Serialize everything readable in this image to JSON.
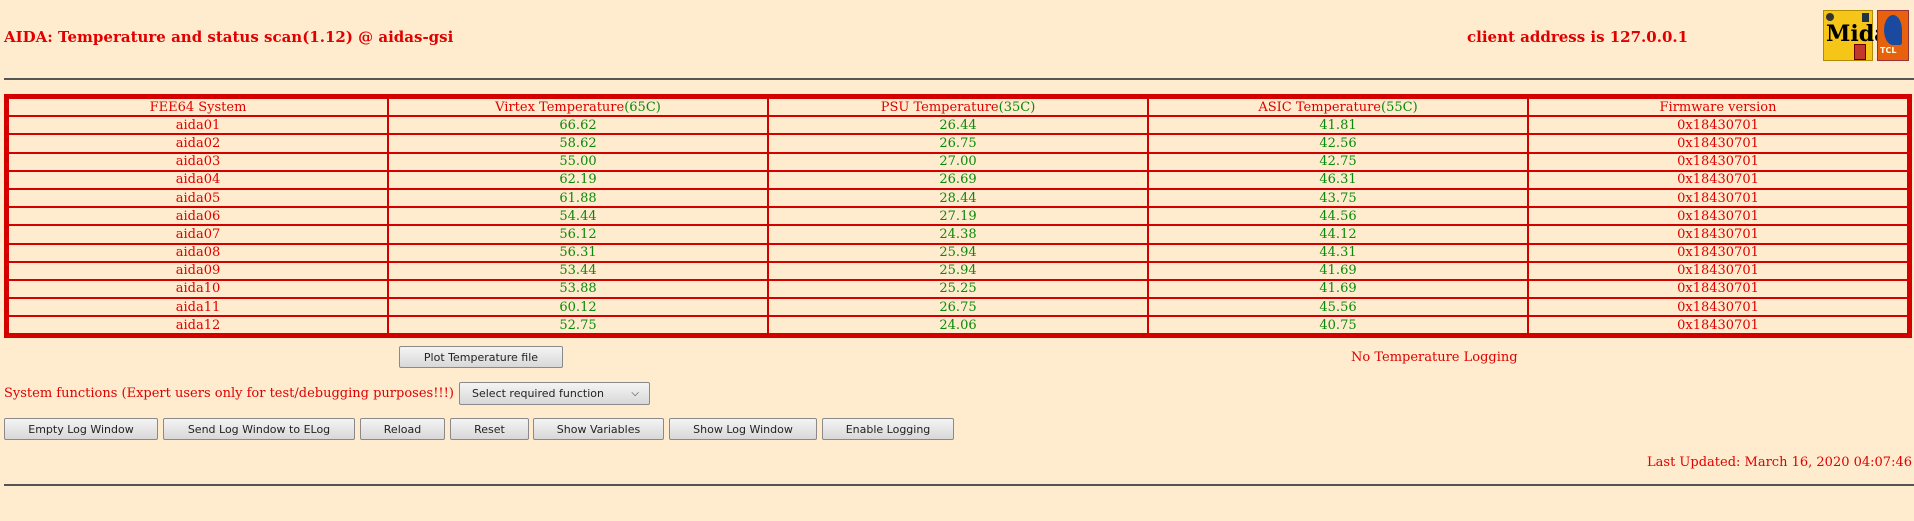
{
  "header": {
    "title": "AIDA: Temperature and status scan(1.12) @ aidas-gsi",
    "client_address": "client address is 127.0.0.1",
    "logo_midas_text": "Midas",
    "logo_tcl_text": "TCL"
  },
  "table": {
    "headers": {
      "system": "FEE64 System",
      "virtex": "Virtex Temperature",
      "virtex_limit": "(65C)",
      "psu": "PSU Temperature",
      "psu_limit": "(35C)",
      "asic": "ASIC Temperature",
      "asic_limit": "(55C)",
      "firmware": "Firmware version"
    },
    "rows": [
      {
        "system": "aida01",
        "virtex": "66.62",
        "psu": "26.44",
        "asic": "41.81",
        "firmware": "0x18430701"
      },
      {
        "system": "aida02",
        "virtex": "58.62",
        "psu": "26.75",
        "asic": "42.56",
        "firmware": "0x18430701"
      },
      {
        "system": "aida03",
        "virtex": "55.00",
        "psu": "27.00",
        "asic": "42.75",
        "firmware": "0x18430701"
      },
      {
        "system": "aida04",
        "virtex": "62.19",
        "psu": "26.69",
        "asic": "46.31",
        "firmware": "0x18430701"
      },
      {
        "system": "aida05",
        "virtex": "61.88",
        "psu": "28.44",
        "asic": "43.75",
        "firmware": "0x18430701"
      },
      {
        "system": "aida06",
        "virtex": "54.44",
        "psu": "27.19",
        "asic": "44.56",
        "firmware": "0x18430701"
      },
      {
        "system": "aida07",
        "virtex": "56.12",
        "psu": "24.38",
        "asic": "44.12",
        "firmware": "0x18430701"
      },
      {
        "system": "aida08",
        "virtex": "56.31",
        "psu": "25.94",
        "asic": "44.31",
        "firmware": "0x18430701"
      },
      {
        "system": "aida09",
        "virtex": "53.44",
        "psu": "25.94",
        "asic": "41.69",
        "firmware": "0x18430701"
      },
      {
        "system": "aida10",
        "virtex": "53.88",
        "psu": "25.25",
        "asic": "41.69",
        "firmware": "0x18430701"
      },
      {
        "system": "aida11",
        "virtex": "60.12",
        "psu": "26.75",
        "asic": "45.56",
        "firmware": "0x18430701"
      },
      {
        "system": "aida12",
        "virtex": "52.75",
        "psu": "24.06",
        "asic": "40.75",
        "firmware": "0x18430701"
      }
    ]
  },
  "controls": {
    "plot_button": "Plot Temperature file",
    "logging_status": "No Temperature Logging",
    "system_functions_label": "System functions (Expert users only for test/debugging purposes!!!)",
    "select_function": "Select required function",
    "buttons": {
      "empty_log": "Empty Log Window",
      "send_log": "Send Log Window to ELog",
      "reload": "Reload",
      "reset": "Reset",
      "show_variables": "Show Variables",
      "show_log": "Show Log Window",
      "enable_logging": "Enable Logging"
    }
  },
  "footer": {
    "last_updated": "Last Updated: March 16, 2020 04:07:46"
  },
  "colors": {
    "background": "#ffebcd",
    "text_red": "#e00000",
    "value_green": "#0a8a0a",
    "table_border": "#d40000"
  }
}
